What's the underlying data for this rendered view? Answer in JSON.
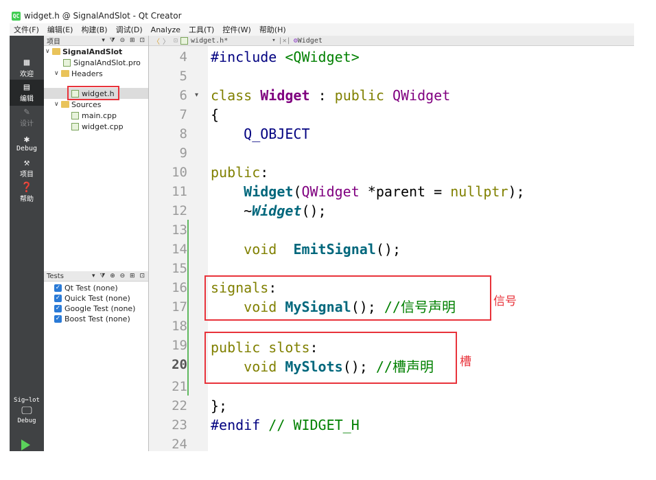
{
  "window": {
    "title": "widget.h @ SignalAndSlot - Qt Creator",
    "app_icon": "QC"
  },
  "menu": [
    "文件(F)",
    "编辑(E)",
    "构建(B)",
    "调试(D)",
    "Analyze",
    "工具(T)",
    "控件(W)",
    "帮助(H)"
  ],
  "modes": [
    {
      "label": "欢迎",
      "icon": "grid-icon"
    },
    {
      "label": "编辑",
      "icon": "edit-icon"
    },
    {
      "label": "设计",
      "icon": "pencil-icon"
    },
    {
      "label": "Debug",
      "icon": "bug-icon"
    },
    {
      "label": "项目",
      "icon": "wrench-icon"
    },
    {
      "label": "帮助",
      "icon": "help-icon"
    }
  ],
  "kit": {
    "project": "Sig⋯lot",
    "config": "Debug"
  },
  "project_panel": {
    "title": "项目",
    "tree": {
      "root": "SignalAndSlot",
      "pro": "SignalAndSlot.pro",
      "headers": "Headers",
      "header_file": "widget.h",
      "sources": "Sources",
      "source_files": [
        "main.cpp",
        "widget.cpp"
      ]
    }
  },
  "tests_panel": {
    "title": "Tests",
    "items": [
      "Qt Test (none)",
      "Quick Test (none)",
      "Google Test (none)",
      "Boost Test (none)"
    ]
  },
  "editor": {
    "tab": "widget.h*",
    "symbol": "Widget",
    "current_line": 20,
    "line_numbers": [
      "4",
      "5",
      "6",
      "7",
      "8",
      "9",
      "10",
      "11",
      "12",
      "13",
      "14",
      "15",
      "16",
      "17",
      "18",
      "19",
      "20",
      "21",
      "22",
      "23",
      "24"
    ],
    "code": {
      "l4": [
        "#include",
        "<QWidget>"
      ],
      "l6": [
        "class",
        "Widget",
        ":",
        "public",
        "QWidget"
      ],
      "l7": "{",
      "l8": "Q_OBJECT",
      "l10": [
        "public",
        ":"
      ],
      "l11": [
        "Widget",
        "(",
        "QWidget",
        " *parent = ",
        "nullptr",
        ");"
      ],
      "l12": [
        "~",
        "Widget",
        "();"
      ],
      "l14": [
        "void",
        "EmitSignal",
        "();"
      ],
      "l16": [
        "signals",
        ":"
      ],
      "l17": [
        "void",
        "MySignal",
        "();",
        "//信号声明"
      ],
      "l19": [
        "public slots",
        ":"
      ],
      "l20": [
        "void",
        "MySlots",
        "();",
        "//槽声明"
      ],
      "l22": "};",
      "l23": [
        "#endif",
        "// WIDGET_H"
      ]
    }
  },
  "annotations": {
    "signal": "信号",
    "slot": "槽"
  },
  "colors": {
    "highlight": "#e8323a",
    "modebar": "#404244",
    "keyword": "#808000",
    "type": "#800080",
    "function": "#00677c",
    "comment": "#008000"
  }
}
